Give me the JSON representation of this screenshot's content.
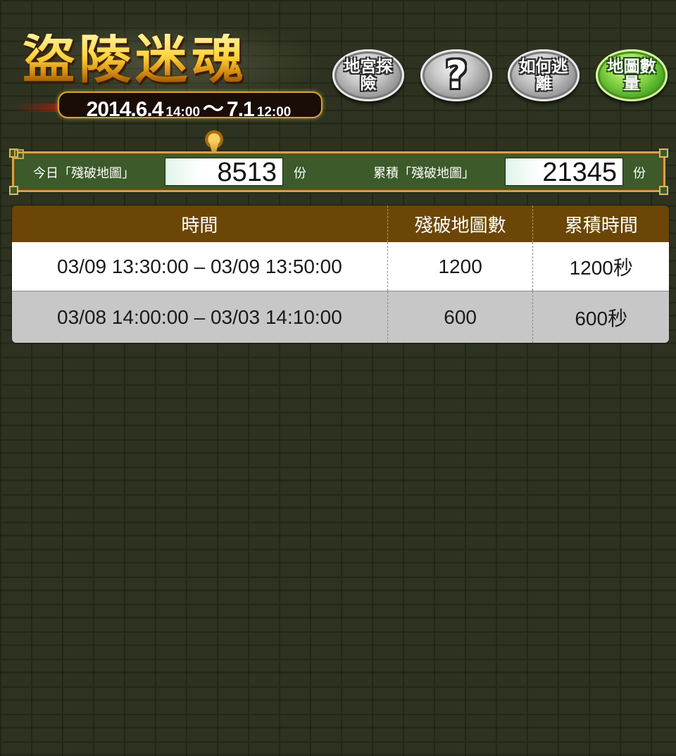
{
  "header": {
    "title": "盜陵迷魂",
    "date_start": "2014.6.4",
    "time_start": "14:00",
    "separator": "～",
    "date_end": "7.1",
    "time_end": "12:00"
  },
  "nav": {
    "explore_label": "地宮探險",
    "help_label": "?",
    "escape_label": "如何逃離",
    "map_count_label": "地圖數量"
  },
  "counter": {
    "today_label": "今日「殘破地圖」",
    "today_value": "8513",
    "today_unit": "份",
    "total_label": "累積「殘破地圖」",
    "total_value": "21345",
    "total_unit": "份"
  },
  "table": {
    "headers": [
      "時間",
      "殘破地圖數",
      "累積時間"
    ],
    "rows": [
      [
        "03/09 13:30:00 – 03/09 13:50:00",
        "1200",
        "1200秒"
      ],
      [
        "03/08 14:00:00 – 03/03 14:10:00",
        "600",
        "600秒"
      ]
    ]
  },
  "colors": {
    "background": "#2d3320",
    "table_header": "#6b4606",
    "counter_bar": "#3c5a2a",
    "gold_border": "#cfa54a",
    "map_button": "#4caf2a"
  }
}
